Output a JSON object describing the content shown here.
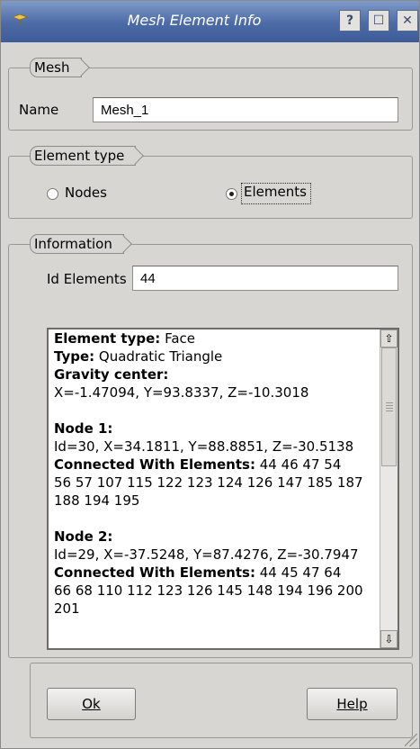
{
  "window": {
    "title": "Mesh Element Info",
    "help_glyph": "?",
    "maximize_glyph": "☐",
    "close_glyph": "✕"
  },
  "mesh_group": {
    "title": "Mesh",
    "name_label": "Name",
    "name_value": "Mesh_1"
  },
  "element_type_group": {
    "title": "Element type",
    "options": [
      {
        "label": "Nodes",
        "selected": false
      },
      {
        "label": "Elements",
        "selected": true
      }
    ]
  },
  "information_group": {
    "title": "Information",
    "id_label": "Id Elements",
    "id_value": "44",
    "info": {
      "element_type_label": "Element type:",
      "element_type_value": " Face",
      "type_label": "Type:",
      "type_value": " Quadratic Triangle",
      "gravity_label": "Gravity center:",
      "gravity_value": "X=-1.47094, Y=93.8337, Z=-10.3018",
      "nodes": [
        {
          "title": "Node 1:",
          "coords": "Id=30, X=34.1811, Y=88.8851, Z=-30.5138",
          "connected_label": "Connected With Elements:",
          "connected_first": " 44 46 47 54",
          "connected_rest": [
            "56 57 107 115 122 123 124 126 147 185 187",
            "188 194 195"
          ]
        },
        {
          "title": "Node 2:",
          "coords": "Id=29, X=-37.5248, Y=87.4276, Z=-30.7947",
          "connected_label": "Connected With Elements:",
          "connected_first": " 44 45 47 64",
          "connected_rest": [
            "66 68 110 112 123 126 145 148 194 196 200",
            "201"
          ]
        }
      ]
    }
  },
  "buttons": {
    "ok_label": "Ok",
    "help_label": "Help"
  },
  "colors": {
    "titlebar": "#4b6aa6",
    "window_bg": "#d8d6d2"
  }
}
